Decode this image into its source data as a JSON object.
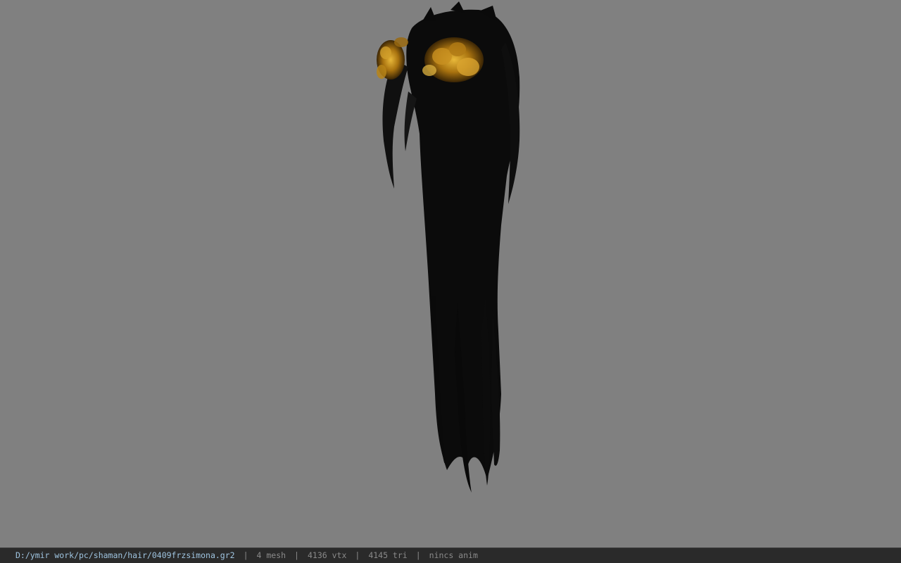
{
  "viewer": {
    "background_color": "#808080",
    "model_icon": "hair-mesh-model-icon"
  },
  "status_bar": {
    "file_path": "D:/ymir work/pc/shaman/hair/0409frzsimona.gr2",
    "separator": "|",
    "mesh_count": "4 mesh",
    "vertex_count": "4136 vtx",
    "triangle_count": "4145 tri",
    "animation": "nincs anim",
    "path_color": "#9fc4e0",
    "text_color": "#8a8a8a"
  }
}
